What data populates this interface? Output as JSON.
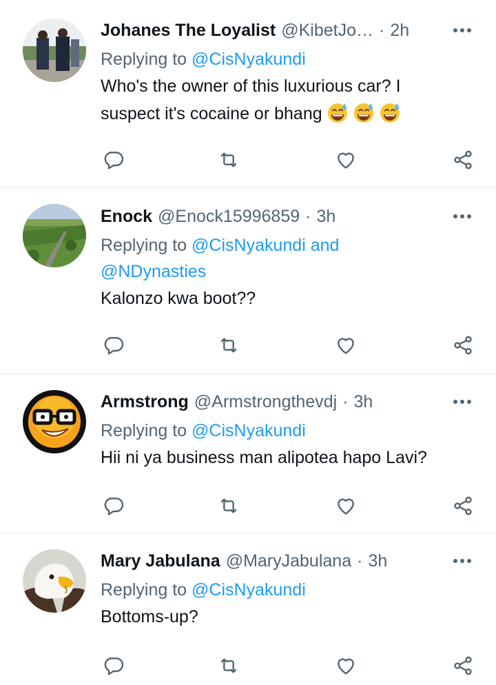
{
  "colors": {
    "accent": "#1d9bf0",
    "muted": "#536471",
    "text": "#0f1419",
    "divider": "#e1e8ed"
  },
  "tweets": [
    {
      "name": "Johanes The Loyalist",
      "handle": "@KibetJo…",
      "dot": "·",
      "time": "2h",
      "replying_prefix": "Replying to",
      "mentions": [
        "@CisNyakundi"
      ],
      "text_line1": "Who's the owner of this luxurious car? I",
      "text_line2": "suspect it's cocaine or bhang",
      "emoji": "grinning-face-with-sweat",
      "emoji_count": 3,
      "avatar": "two-men-in-suits"
    },
    {
      "name": "Enock",
      "handle": "@Enock15996859",
      "dot": "·",
      "time": "3h",
      "replying_prefix": "Replying to",
      "mentions": [
        "@CisNyakundi",
        "@NDynasties"
      ],
      "joiner": "and",
      "text_line1": "Kalonzo kwa boot??",
      "avatar": "green-landscape"
    },
    {
      "name": "Armstrong",
      "handle": "@Armstrongthevdj",
      "dot": "·",
      "time": "3h",
      "replying_prefix": "Replying to",
      "mentions": [
        "@CisNyakundi"
      ],
      "text_line1": "Hii ni ya business man alipotea hapo Lavi?",
      "avatar": "nerd-smiley"
    },
    {
      "name": "Mary Jabulana",
      "handle": "@MaryJabulana",
      "dot": "·",
      "time": "3h",
      "replying_prefix": "Replying to",
      "mentions": [
        "@CisNyakundi"
      ],
      "text_line1": "Bottoms-up?",
      "avatar": "bald-eagle"
    }
  ],
  "icons": {
    "reply": "reply-icon",
    "retweet": "retweet-icon",
    "like": "like-icon",
    "share": "share-icon",
    "more": "more-icon"
  }
}
